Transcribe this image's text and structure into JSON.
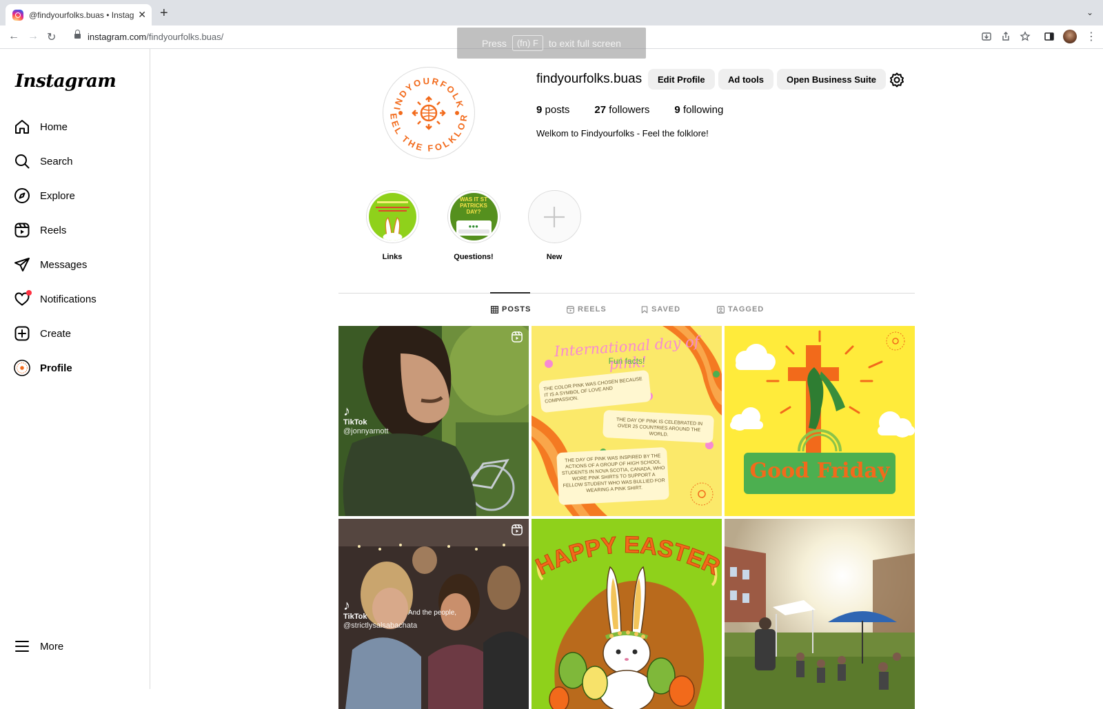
{
  "browser": {
    "tab_title": "@findyourfolks.buas • Instagram",
    "url_host": "instagram.com",
    "url_path": "/findyourfolks.buas/",
    "fullscreen_hint": {
      "press": "Press",
      "key": "(fn) F",
      "suffix": "to exit full screen"
    }
  },
  "sidebar": {
    "logo": "Instagram",
    "items": [
      {
        "label": "Home",
        "icon": "home-icon"
      },
      {
        "label": "Search",
        "icon": "search-icon"
      },
      {
        "label": "Explore",
        "icon": "compass-icon"
      },
      {
        "label": "Reels",
        "icon": "reels-icon"
      },
      {
        "label": "Messages",
        "icon": "messages-icon"
      },
      {
        "label": "Notifications",
        "icon": "heart-icon"
      },
      {
        "label": "Create",
        "icon": "plus-square-icon"
      },
      {
        "label": "Profile",
        "icon": "profile-avatar-icon"
      }
    ],
    "more_label": "More"
  },
  "profile": {
    "username": "findyourfolks.buas",
    "buttons": {
      "edit": "Edit Profile",
      "ad_tools": "Ad tools",
      "business": "Open Business Suite"
    },
    "stats": {
      "posts_count": "9",
      "posts_label": "posts",
      "followers_count": "27",
      "followers_label": "followers",
      "following_count": "9",
      "following_label": "following"
    },
    "bio": "Welkom to Findyourfolks - Feel the folklore!",
    "avatar_ring_top": "FINDYOURFOLKS",
    "avatar_ring_bottom": "FEEL THE FOLKLORE"
  },
  "highlights": [
    {
      "label": "Links"
    },
    {
      "label": "Questions!",
      "cover_text": "WAS IT ST PATRICKS DAY?"
    },
    {
      "label": "New"
    }
  ],
  "tabs": [
    {
      "label": "POSTS",
      "active": true
    },
    {
      "label": "REELS",
      "active": false
    },
    {
      "label": "SAVED",
      "active": false
    },
    {
      "label": "TAGGED",
      "active": false
    }
  ],
  "posts": {
    "p1": {
      "brand": "TikTok",
      "handle": "@jonnyarnott"
    },
    "p2": {
      "title": "International day of pink!",
      "subtitle": "Fun facts!",
      "fact1": "THE COLOR PINK WAS CHOSEN BECAUSE IT IS A SYMBOL OF LOVE AND COMPASSION.",
      "fact2": "THE DAY OF PINK IS CELEBRATED IN OVER 25 COUNTRIES AROUND THE WORLD.",
      "fact3": "THE DAY OF PINK WAS INSPIRED BY THE ACTIONS OF A GROUP OF HIGH SCHOOL STUDENTS IN NOVA SCOTIA, CANADA, WHO WORE PINK SHIRTS TO SUPPORT A FELLOW STUDENT WHO WAS BULLIED FOR WEARING A PINK SHIRT."
    },
    "p3": {
      "banner": "Good Friday"
    },
    "p4": {
      "brand": "TikTok",
      "handle": "@strictlysalsabachata",
      "caption": "And the people,"
    },
    "p5": {
      "title": "HAPPY EASTER"
    },
    "p6": {}
  },
  "colors": {
    "brand_orange": "#f26a1b",
    "lime": "#8fd11b",
    "yellow": "#ffeb3b",
    "pink_post_bg": "#fbe96a",
    "notif_red": "#ff3040"
  }
}
